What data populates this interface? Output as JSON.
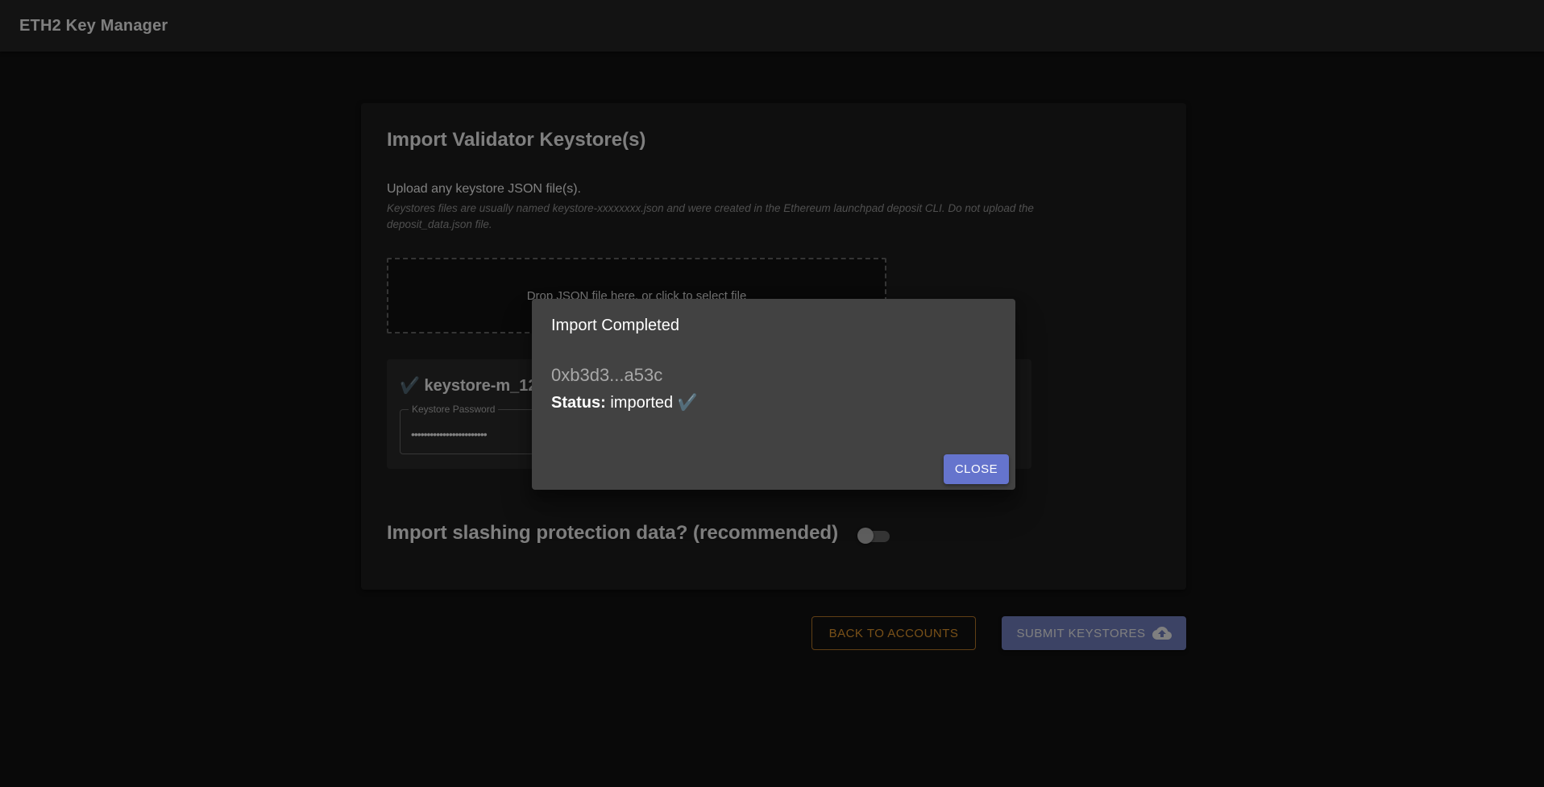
{
  "app": {
    "title": "ETH2 Key Manager"
  },
  "import_card": {
    "title": "Import Validator Keystore(s)",
    "upload_label": "Upload any keystore JSON file(s).",
    "upload_hint": "Keystores files are usually named keystore-xxxxxxxx.json and were created in the Ethereum launchpad deposit CLI. Do not upload the deposit_data.json file.",
    "dropzone_text": "Drop JSON file here, or click to select file",
    "keystore": {
      "name": "✔️ keystore-m_12381_3600_0_0_0-1622016040.json",
      "password_label": "Keystore Password",
      "password_value": "••••••••••••••••••••••••"
    },
    "slashing_label": "Import slashing protection data? (recommended)",
    "slashing_enabled": false
  },
  "actions": {
    "back_label": "BACK TO ACCOUNTS",
    "submit_label": "SUBMIT KEYSTORES",
    "submit_icon": "cloud-upload-icon"
  },
  "dialog": {
    "title": "Import Completed",
    "pubkey": "0xb3d3...a53c",
    "status_label": "Status:",
    "status_value": "imported ✔️",
    "close_label": "CLOSE"
  },
  "colors": {
    "primary": "#7986cb",
    "secondary": "#f0a030",
    "surface": "#1e1e1e",
    "dialog": "#424242"
  }
}
